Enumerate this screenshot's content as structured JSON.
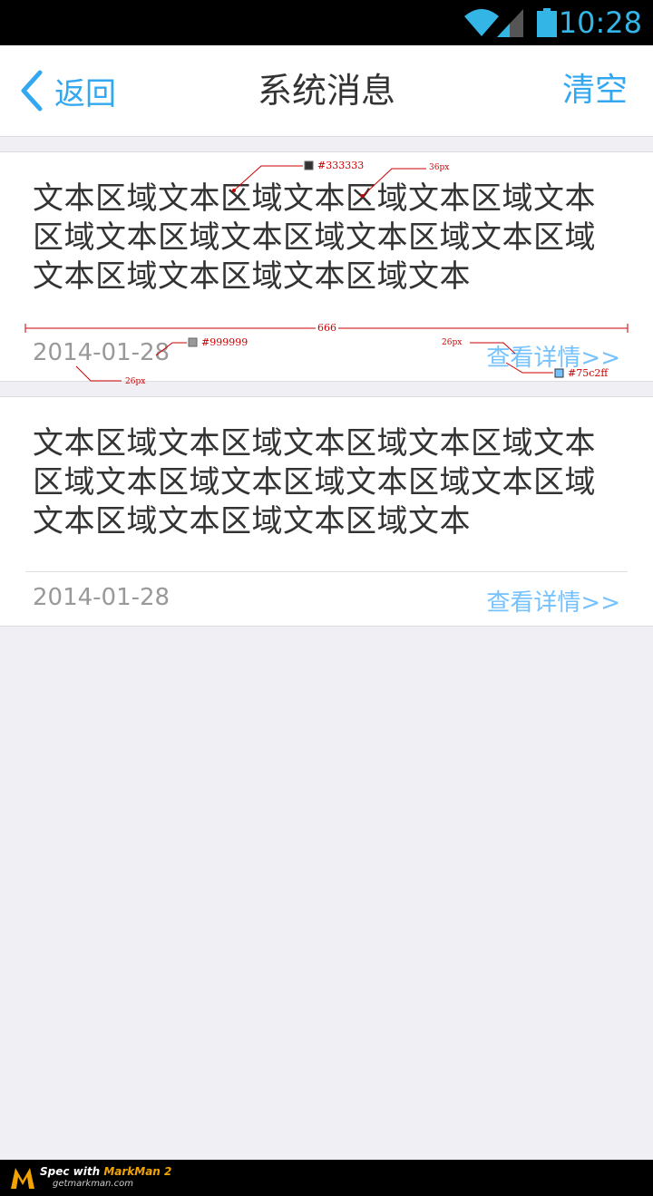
{
  "status_bar": {
    "time": "10:28",
    "icons": [
      "wifi-icon",
      "signal-icon",
      "battery-icon"
    ],
    "accent_color": "#33b5e5"
  },
  "nav": {
    "back_label": "返回",
    "title": "系统消息",
    "clear_label": "清空",
    "accent_color": "#33a8f0"
  },
  "messages": [
    {
      "text": "文本区域文本区域文本区域文本区域文本区域文本区域文本区域文本区域文本区域文本区域文本区域文本区域文本",
      "date": "2014-01-28",
      "link": "查看详情>>"
    },
    {
      "text": "文本区域文本区域文本区域文本区域文本区域文本区域文本区域文本区域文本区域文本区域文本区域文本区域文本",
      "date": "2014-01-28",
      "link": "查看详情>>"
    }
  ],
  "annotations": {
    "text_color": "#333333",
    "text_size": "36px",
    "width": "666",
    "date_color": "#999999",
    "date_size": "26px",
    "link_size": "26px",
    "link_color": "#75c2ff"
  },
  "footer": {
    "spec_prefix": "Spec with ",
    "brand": "MarkMan 2",
    "site": "getmarkman.com"
  },
  "colors": {
    "text": "#333333",
    "date": "#999999",
    "link": "#75c2ff",
    "background": "#efeff4"
  }
}
